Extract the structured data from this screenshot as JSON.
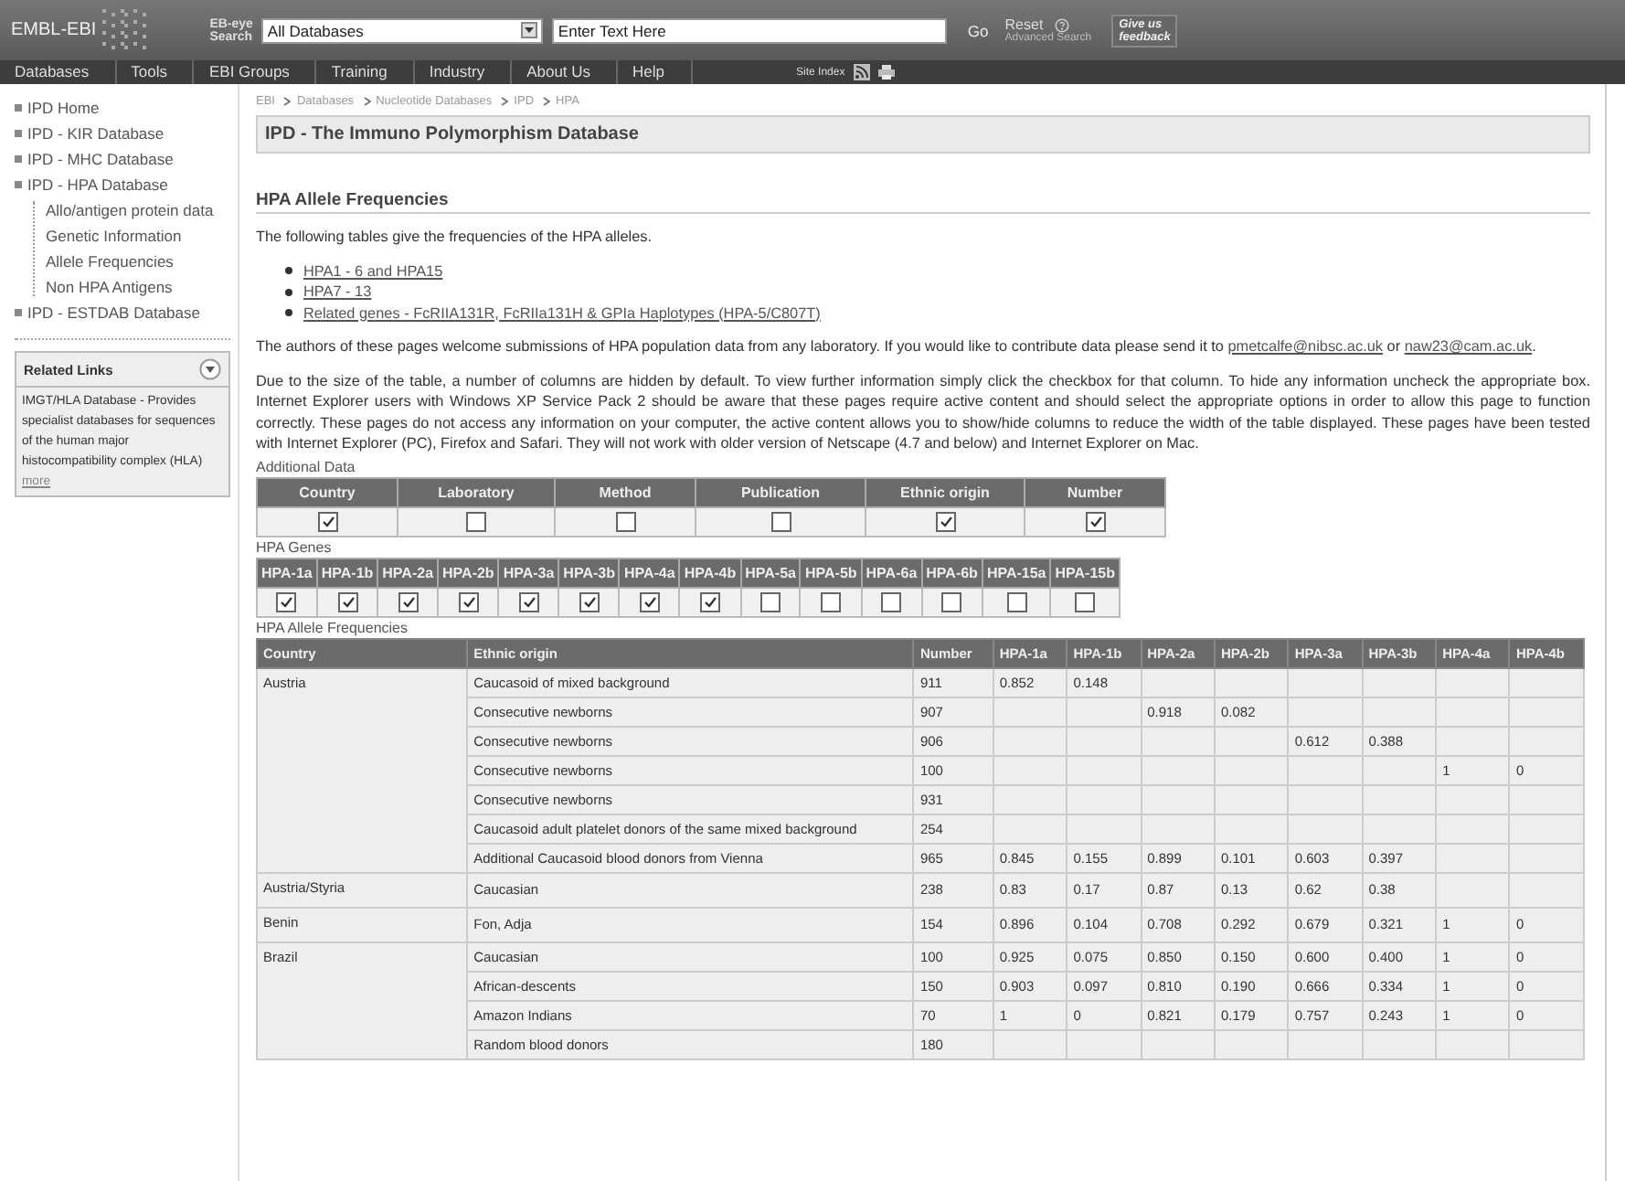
{
  "header": {
    "logo": "EMBL-EBI",
    "search_label": [
      "EB-eye",
      "Search"
    ],
    "database_select": "All Databases",
    "search_field": {
      "placeholder": "Enter Text Here"
    },
    "go": "Go",
    "reset": "Reset",
    "advanced": "Advanced Search",
    "feedback": [
      "Give us",
      "feedback"
    ]
  },
  "nav": {
    "items": [
      "Databases",
      "Tools",
      "EBI Groups",
      "Training",
      "Industry",
      "About Us",
      "Help"
    ],
    "site_index": "Site Index"
  },
  "sidebar": {
    "items": [
      {
        "label": "IPD Home"
      },
      {
        "label": "IPD - KIR Database"
      },
      {
        "label": "IPD - MHC Database"
      },
      {
        "label": "IPD - HPA Database",
        "children": [
          {
            "label": "Allo/antigen protein data"
          },
          {
            "label": "Genetic Information"
          },
          {
            "label": "Allele Frequencies"
          },
          {
            "label": "Non HPA Antigens"
          }
        ]
      },
      {
        "label": "IPD - ESTDAB Database"
      }
    ],
    "related": {
      "title": "Related Links",
      "text": "IMGT/HLA Database - Provides specialist databases for sequences of the human major histocompatibility complex (HLA)",
      "more": "more"
    }
  },
  "breadcrumb": [
    "EBI",
    "Databases",
    "Nucleotide Databases",
    "IPD",
    "HPA"
  ],
  "page_title": "IPD - The Immuno Polymorphism Database",
  "heading": "HPA Allele Frequencies",
  "intro": "The following tables give the frequencies of the HPA alleles.",
  "links": [
    "HPA1 - 6 and HPA15",
    "HPA7 - 13",
    "Related genes - FcRIIA131R, FcRIIa131H & GPIa Haplotypes (HPA-5/C807T)"
  ],
  "contribute": {
    "text": "The authors of these pages welcome submissions of HPA population data from any laboratory. If you would like to contribute data please send it to ",
    "email_1": "pmetcalfe@nibsc.ac.uk",
    "middle": " or ",
    "email_2": "naw23@cam.ac.uk",
    "end": "."
  },
  "notice": "Due to the size of the table, a number of columns are hidden by default. To view further information simply click the checkbox for that column. To hide any information uncheck the appropriate box. Internet Explorer users with Windows XP Service Pack 2 should be aware that these pages require active content and should select the appropriate options in order to allow this page to function correctly. These pages do not access any information on your computer, the active content allows you to show/hide columns to reduce the width of the table displayed. These pages have been tested with Internet Explorer (PC), Firefox and Safari. They will not work with older version of Netscape (4.7 and below) and Internet Explorer on Mac.",
  "additional_data": {
    "title": "Additional Data",
    "columns": [
      {
        "label": "Country",
        "checked": true
      },
      {
        "label": "Laboratory",
        "checked": false
      },
      {
        "label": "Method",
        "checked": false
      },
      {
        "label": "Publication",
        "checked": false
      },
      {
        "label": "Ethnic origin",
        "checked": true
      },
      {
        "label": "Number",
        "checked": true
      }
    ]
  },
  "hpa_genes": {
    "title": "HPA Genes",
    "columns": [
      {
        "label": "HPA-1a",
        "checked": true
      },
      {
        "label": "HPA-1b",
        "checked": true
      },
      {
        "label": "HPA-2a",
        "checked": true
      },
      {
        "label": "HPA-2b",
        "checked": true
      },
      {
        "label": "HPA-3a",
        "checked": true
      },
      {
        "label": "HPA-3b",
        "checked": true
      },
      {
        "label": "HPA-4a",
        "checked": true
      },
      {
        "label": "HPA-4b",
        "checked": true
      },
      {
        "label": "HPA-5a",
        "checked": false
      },
      {
        "label": "HPA-5b",
        "checked": false
      },
      {
        "label": "HPA-6a",
        "checked": false
      },
      {
        "label": "HPA-6b",
        "checked": false
      },
      {
        "label": "HPA-15a",
        "checked": false
      },
      {
        "label": "HPA-15b",
        "checked": false
      }
    ]
  },
  "frequencies": {
    "title": "HPA Allele Frequencies",
    "columns": [
      "Country",
      "Ethnic origin",
      "Number",
      "HPA-1a",
      "HPA-1b",
      "HPA-2a",
      "HPA-2b",
      "HPA-3a",
      "HPA-3b",
      "HPA-4a",
      "HPA-4b"
    ],
    "groups": [
      {
        "country": "Austria",
        "rows": [
          {
            "cells": [
              "Caucasoid of mixed background",
              "911",
              "0.852",
              "0.148",
              null,
              null,
              null,
              null,
              null,
              null
            ]
          },
          {
            "cells": [
              "Consecutive newborns",
              "907",
              null,
              null,
              "0.918",
              "0.082",
              null,
              null,
              null,
              null
            ]
          },
          {
            "cells": [
              "Consecutive newborns",
              "906",
              null,
              null,
              null,
              null,
              "0.612",
              "0.388",
              null,
              null
            ]
          },
          {
            "cells": [
              "Consecutive newborns",
              "100",
              null,
              null,
              null,
              null,
              null,
              null,
              "1",
              "0"
            ]
          },
          {
            "cells": [
              "Consecutive newborns",
              "931",
              null,
              null,
              null,
              null,
              null,
              null,
              null,
              null
            ]
          },
          {
            "cells": [
              "Caucasoid adult platelet donors of the same mixed background",
              "254",
              null,
              null,
              null,
              null,
              null,
              null,
              null,
              null
            ]
          },
          {
            "cells": [
              "Additional Caucasoid blood donors from Vienna",
              "965",
              "0.845",
              "0.155",
              "0.899",
              "0.101",
              "0.603",
              "0.397",
              null,
              null
            ]
          }
        ]
      },
      {
        "country": "Austria/Styria",
        "rows": [
          {
            "cells": [
              "Caucasian",
              "238",
              "0.83",
              "0.17",
              "0.87",
              "0.13",
              "0.62",
              "0.38",
              null,
              null
            ]
          }
        ]
      },
      {
        "country": "Benin",
        "rows": [
          {
            "cells": [
              "Fon, Adja",
              "154",
              "0.896",
              "0.104",
              "0.708",
              "0.292",
              "0.679",
              "0.321",
              "1",
              "0"
            ]
          }
        ]
      },
      {
        "country": "Brazil",
        "rows": [
          {
            "cells": [
              "Caucasian",
              "100",
              "0.925",
              "0.075",
              "0.850",
              "0.150",
              "0.600",
              "0.400",
              "1",
              "0"
            ]
          },
          {
            "cells": [
              "African-descents",
              "150",
              "0.903",
              "0.097",
              "0.810",
              "0.190",
              "0.666",
              "0.334",
              "1",
              "0"
            ]
          },
          {
            "cells": [
              "Amazon Indians",
              "70",
              "1",
              "0",
              "0.821",
              "0.179",
              "0.757",
              "0.243",
              "1",
              "0"
            ]
          },
          {
            "cells": [
              "Random blood donors",
              "180",
              null,
              null,
              null,
              null,
              null,
              null,
              null,
              null
            ]
          }
        ]
      }
    ]
  }
}
